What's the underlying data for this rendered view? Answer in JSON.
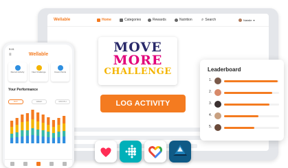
{
  "tablet": {
    "brand": "Wellable",
    "nav": [
      {
        "label": "Home",
        "icon": "home-icon",
        "active": true
      },
      {
        "label": "Categories",
        "icon": "grid-icon"
      },
      {
        "label": "Rewards",
        "icon": "rewards-icon"
      },
      {
        "label": "Nutrition",
        "icon": "nutrition-icon"
      },
      {
        "label": "Search",
        "icon": "search-icon"
      }
    ],
    "user": "Natalie"
  },
  "logo": {
    "line1": "MOVE",
    "line2": "MORE",
    "line3": "CHALLENGE"
  },
  "log_button": "LOG ACTIVITY",
  "leaderboard": {
    "title": "Leaderboard",
    "rows": [
      {
        "rank": "1.",
        "progress": 0.98,
        "avatar_color": "#7a5a4a"
      },
      {
        "rank": "2.",
        "progress": 0.88,
        "avatar_color": "#d88a6a"
      },
      {
        "rank": "3.",
        "progress": 0.82,
        "avatar_color": "#3a3030"
      },
      {
        "rank": "4.",
        "progress": 0.62,
        "avatar_color": "#c8a080"
      },
      {
        "rank": "5.",
        "progress": 0.55,
        "avatar_color": "#6a4a3a"
      }
    ]
  },
  "phone": {
    "time": "9:41",
    "brand": "Wellable",
    "cards": [
      {
        "label": "Record Activity",
        "color": "#2f8fe0"
      },
      {
        "label": "New Challenge",
        "color": "#f4b400"
      },
      {
        "label": "Invest Points",
        "color": "#2f8fe0"
      }
    ],
    "performance_title": "Your Performance",
    "tabs": [
      "DAY",
      "WEEK",
      "MONTH"
    ]
  },
  "colors": {
    "accent": "#f47b20",
    "bar_blue": "#2f8fe0",
    "bar_teal": "#37b8a6",
    "bar_yellow": "#f4b400",
    "bar_orange": "#f47b20"
  },
  "apps": [
    {
      "name": "Apple Health",
      "icon": "apple-health-icon"
    },
    {
      "name": "Fitbit",
      "icon": "fitbit-icon"
    },
    {
      "name": "Google Fit",
      "icon": "google-fit-icon"
    },
    {
      "name": "Garmin",
      "icon": "garmin-icon"
    }
  ]
}
